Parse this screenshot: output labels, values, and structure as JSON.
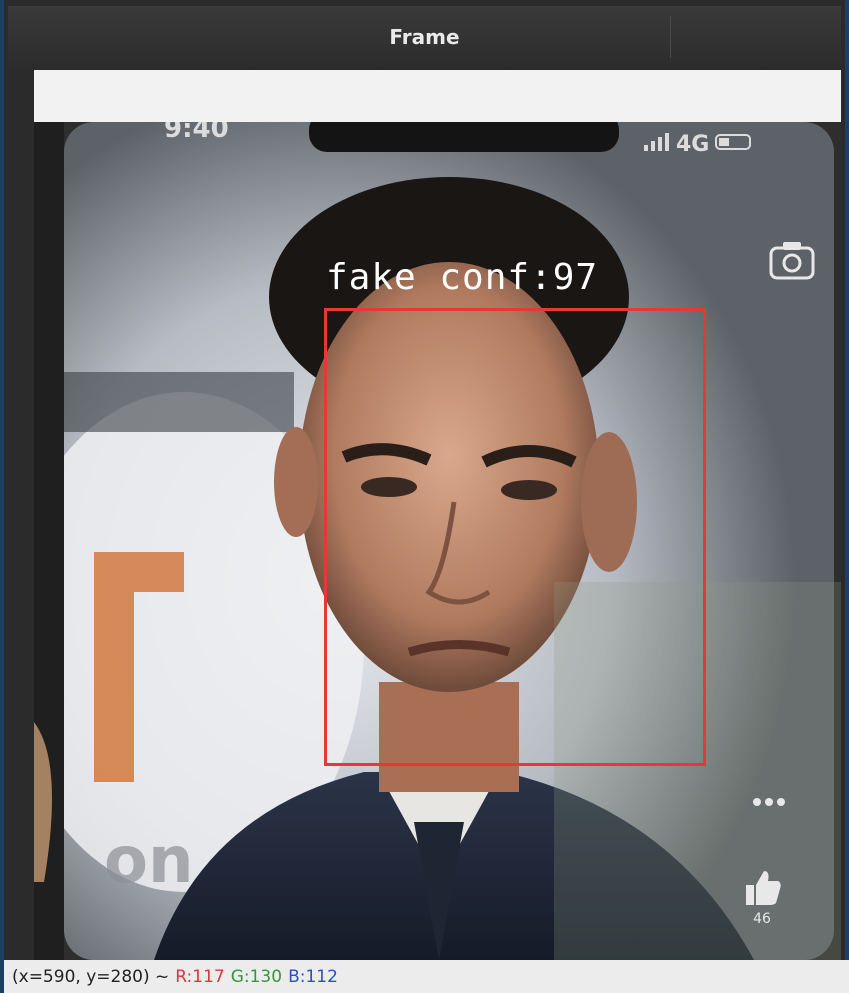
{
  "window": {
    "title": "Frame"
  },
  "overlay": {
    "label": "fake conf:97",
    "box_color": "#e53935"
  },
  "phone_ui": {
    "time": "9:40",
    "signal": "4G",
    "like_count": "46",
    "icons": [
      "camera-icon",
      "more-icon",
      "thumbs-up-icon",
      "signal-icon",
      "battery-icon"
    ]
  },
  "statusbar": {
    "coords": "(x=590, y=280) ~",
    "r": "R:117",
    "g": "G:130",
    "b": "B:112"
  },
  "colors": {
    "r_text": "#d23b3b",
    "g_text": "#2f9a3a",
    "b_text": "#2b4fc4",
    "window_border": "#1c3f66"
  }
}
